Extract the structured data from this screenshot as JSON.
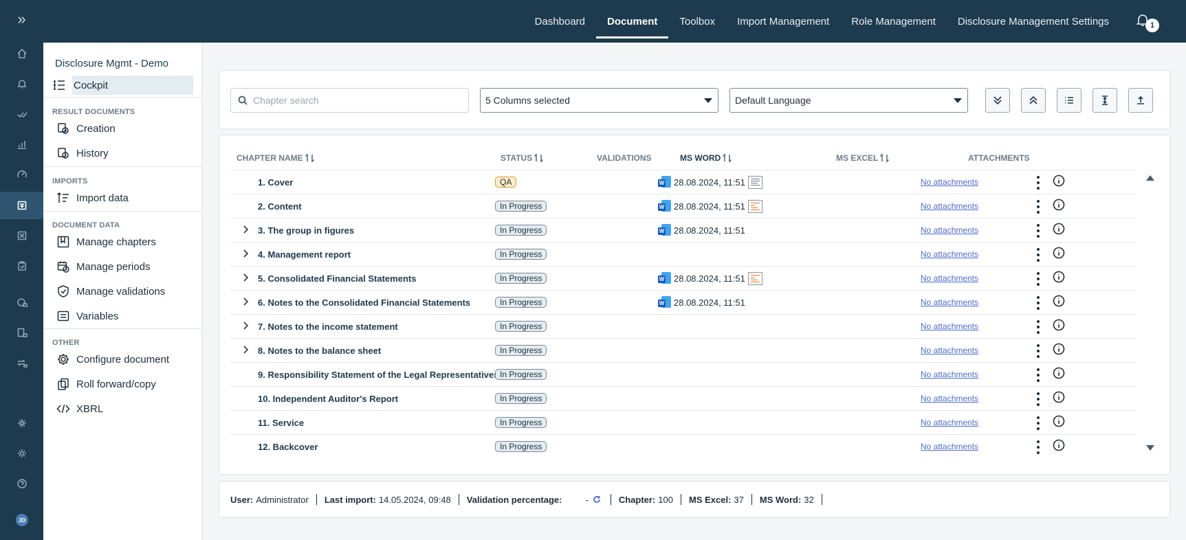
{
  "topnav": {
    "tabs": [
      "Dashboard",
      "Document",
      "Toolbox",
      "Import Management",
      "Role Management",
      "Disclosure Management Settings"
    ],
    "active": "Document",
    "notification_count": "1"
  },
  "user": {
    "initials": "JD"
  },
  "sidebar": {
    "title": "Disclosure Mgmt - Demo",
    "cockpit": "Cockpit",
    "sections": {
      "result_documents": "RESULT DOCUMENTS",
      "imports": "IMPORTS",
      "document_data": "DOCUMENT DATA",
      "other": "OTHER"
    },
    "items": {
      "creation": "Creation",
      "history": "History",
      "import_data": "Import data",
      "manage_chapters": "Manage chapters",
      "manage_periods": "Manage periods",
      "manage_validations": "Manage validations",
      "variables": "Variables",
      "configure_document": "Configure document",
      "roll_forward": "Roll forward/copy",
      "xbrl": "XBRL"
    }
  },
  "toolbar": {
    "search_placeholder": "Chapter search",
    "columns_select": "5 Columns selected",
    "language_select": "Default Language"
  },
  "table": {
    "headers": {
      "chapter_name": "CHAPTER NAME",
      "status": "STATUS",
      "validations": "VALIDATIONS",
      "ms_word": "MS WORD",
      "ms_excel": "MS EXCEL",
      "attachments": "ATTACHMENTS"
    },
    "rows": [
      {
        "name": "1. Cover",
        "status": "QA",
        "word": "28.08.2024, 11:51",
        "doc": "text",
        "attachments": "No attachments",
        "expandable": false
      },
      {
        "name": "2. Content",
        "status": "In Progress",
        "word": "28.08.2024, 11:51",
        "doc": "pres",
        "attachments": "No attachments",
        "expandable": false
      },
      {
        "name": "3. The group in figures",
        "status": "In Progress",
        "word": "28.08.2024, 11:51",
        "doc": "",
        "attachments": "No attachments",
        "expandable": true
      },
      {
        "name": "4. Management report",
        "status": "In Progress",
        "word": "",
        "doc": "",
        "attachments": "No attachments",
        "expandable": true
      },
      {
        "name": "5. Consolidated Financial Statements",
        "status": "In Progress",
        "word": "28.08.2024, 11:51",
        "doc": "pres",
        "attachments": "No attachments",
        "expandable": true
      },
      {
        "name": "6. Notes to the Consolidated Financial Statements",
        "status": "In Progress",
        "word": "28.08.2024, 11:51",
        "doc": "",
        "attachments": "No attachments",
        "expandable": true
      },
      {
        "name": "7. Notes to the income statement",
        "status": "In Progress",
        "word": "",
        "doc": "",
        "attachments": "No attachments",
        "expandable": true
      },
      {
        "name": "8. Notes to the balance sheet",
        "status": "In Progress",
        "word": "",
        "doc": "",
        "attachments": "No attachments",
        "expandable": true
      },
      {
        "name": "9. Responsibility Statement of the Legal Representatives",
        "status": "In Progress",
        "word": "",
        "doc": "",
        "attachments": "No attachments",
        "expandable": false
      },
      {
        "name": "10. Independent Auditor's Report",
        "status": "In Progress",
        "word": "",
        "doc": "",
        "attachments": "No attachments",
        "expandable": false
      },
      {
        "name": "11. Service",
        "status": "In Progress",
        "word": "",
        "doc": "",
        "attachments": "No attachments",
        "expandable": false
      },
      {
        "name": "12. Backcover",
        "status": "In Progress",
        "word": "",
        "doc": "",
        "attachments": "No attachments",
        "expandable": false
      }
    ]
  },
  "footer": {
    "user_label": "User:",
    "user_value": "Administrator",
    "import_label": "Last import:",
    "import_value": "14.05.2024, 09:48",
    "validation_label": "Validation percentage:",
    "validation_value": "-",
    "chapter_label": "Chapter:",
    "chapter_value": "100",
    "excel_label": "MS Excel:",
    "excel_value": "37",
    "word_label": "MS Word:",
    "word_value": "32"
  },
  "colors": {
    "navy": "#1d3a4f",
    "status_qa": "#fdecc8",
    "status_progress": "#e2ecf1",
    "link": "#4d6cc9"
  }
}
